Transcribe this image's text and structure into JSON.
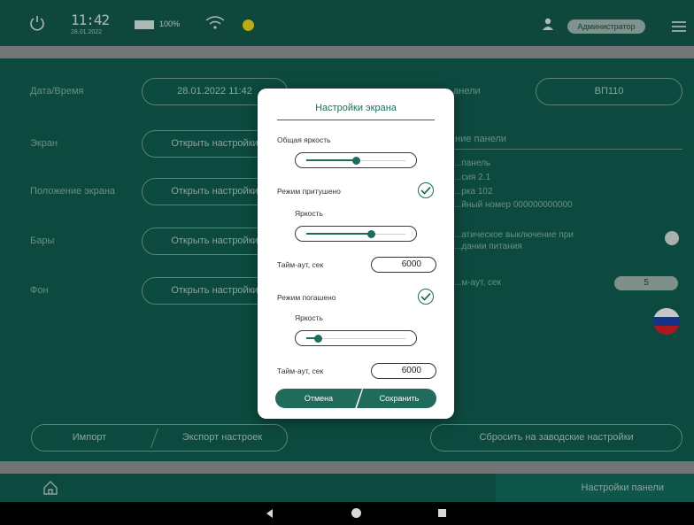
{
  "statusbar": {
    "time": "11:42",
    "date": "28.01.2022",
    "battery": "100%",
    "user": "Администратор"
  },
  "settings": {
    "datetime_label": "Дата/Время",
    "datetime_value": "28.01.2022 11:42",
    "screen_label": "Экран",
    "screen_btn": "Открыть настройки",
    "position_label": "Положение экрана",
    "position_btn": "Открыть настройки",
    "bars_label": "Бары",
    "bars_btn": "Открыть настройки",
    "bg_label": "Фон",
    "bg_btn": "Открыть настройки",
    "panel_label": "...анели",
    "panel_value": "ВП110",
    "panel_desc_header": "...ние панели",
    "desc_lines": [
      "...панель",
      "...сия 2.1",
      "...рка 102",
      "...йный номер 000000000000"
    ],
    "auto_off_line1": "...атическое выключение при",
    "auto_off_line2": "...дании питания",
    "timeout_label": "...м-аут, сек",
    "timeout_value": "5"
  },
  "footer": {
    "import": "Импорт",
    "export": "Экспорт настроек",
    "reset": "Сбросить на заводские настройки"
  },
  "nav": {
    "tab": "Настройки панели"
  },
  "dialog": {
    "title": "Настройки экрана",
    "brightness_label": "Общая яркость",
    "brightness_value": 0.5,
    "dim_mode_label": "Режим притушено",
    "dim_mode_checked": true,
    "dim_brightness_label": "Яркость",
    "dim_brightness_value": 0.66,
    "dim_timeout_label": "Тайм-аут, сек",
    "dim_timeout_value": "6000",
    "off_mode_label": "Режим погашено",
    "off_mode_checked": true,
    "off_brightness_label": "Яркость",
    "off_brightness_value": 0.12,
    "off_timeout_label": "Тайм-аут, сек",
    "off_timeout_value": "6000",
    "cancel": "Отмена",
    "save": "Сохранить"
  },
  "colors": {
    "primary": "#1f6b5c",
    "background": "#0f5a4c",
    "flag_white": "#f2f2f2",
    "flag_blue": "#1d3fa0",
    "flag_red": "#d11f25"
  }
}
